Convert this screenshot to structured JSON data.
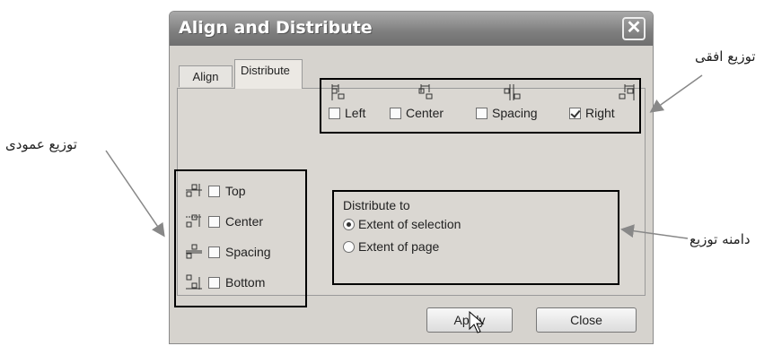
{
  "dialog": {
    "title": "Align and Distribute",
    "close_glyph": "✕"
  },
  "tabs": [
    {
      "label": "Align"
    },
    {
      "label": "Distribute"
    }
  ],
  "horizontal": {
    "items": [
      {
        "label": "Left",
        "checked": false,
        "icon": "distribute-left-icon"
      },
      {
        "label": "Center",
        "checked": false,
        "icon": "distribute-center-h-icon"
      },
      {
        "label": "Spacing",
        "checked": false,
        "icon": "distribute-spacing-h-icon"
      },
      {
        "label": "Right",
        "checked": true,
        "icon": "distribute-right-icon"
      }
    ]
  },
  "vertical": {
    "items": [
      {
        "label": "Top",
        "checked": false,
        "icon": "distribute-top-icon"
      },
      {
        "label": "Center",
        "checked": false,
        "icon": "distribute-center-v-icon"
      },
      {
        "label": "Spacing",
        "checked": false,
        "icon": "distribute-spacing-v-icon"
      },
      {
        "label": "Bottom",
        "checked": false,
        "icon": "distribute-bottom-icon"
      }
    ]
  },
  "distribute_to": {
    "heading": "Distribute to",
    "options": [
      {
        "label": "Extent of selection",
        "selected": true
      },
      {
        "label": "Extent of page",
        "selected": false
      }
    ]
  },
  "buttons": {
    "apply": "Apply",
    "close": "Close"
  },
  "annotations": {
    "horizontal": "توزیع افقی",
    "vertical": "توزیع عمودی",
    "range": "دامنه توزیع"
  }
}
